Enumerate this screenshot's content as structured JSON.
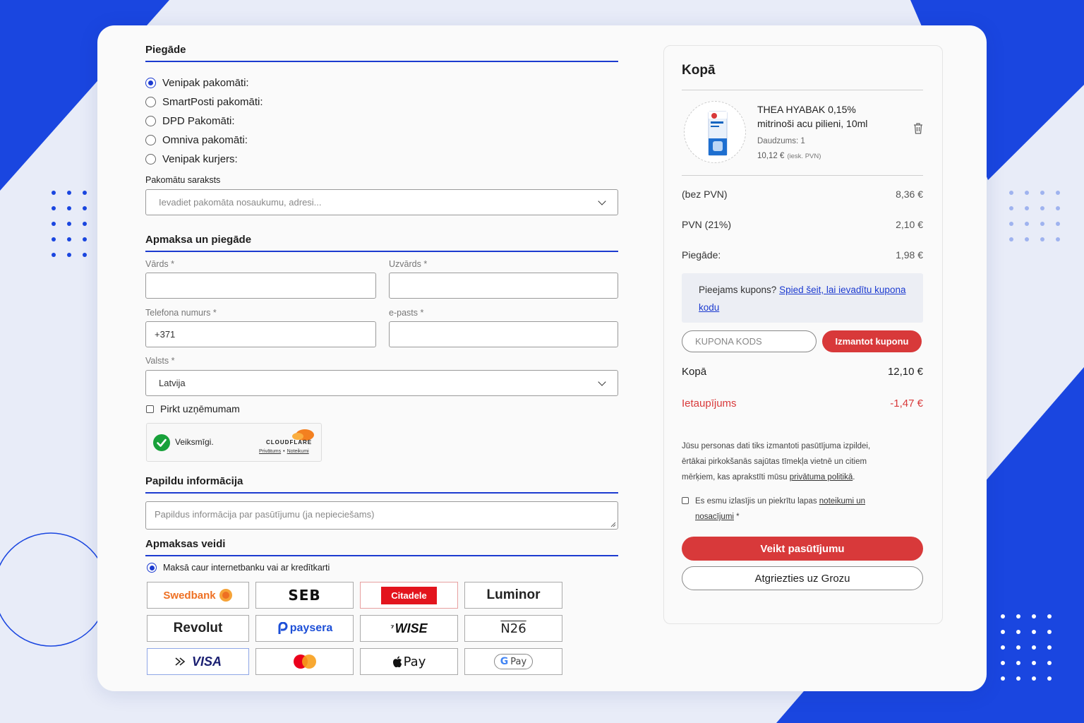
{
  "delivery": {
    "title": "Piegāde",
    "options": [
      {
        "label": "Venipak pakomāti:",
        "selected": true
      },
      {
        "label": "SmartPosti pakomāti:",
        "selected": false
      },
      {
        "label": "DPD Pakomāti:",
        "selected": false
      },
      {
        "label": "Omniva pakomāti:",
        "selected": false
      },
      {
        "label": "Venipak kurjers:",
        "selected": false
      }
    ],
    "locker_list_label": "Pakomātu saraksts",
    "locker_placeholder": "Ievadiet pakomāta nosaukumu, adresi..."
  },
  "billing": {
    "title": "Apmaksa un piegāde",
    "first_name_label": "Vārds *",
    "first_name_value": "",
    "last_name_label": "Uzvārds *",
    "last_name_value": "",
    "phone_label": "Telefona numurs *",
    "phone_value": "+371",
    "email_label": "e-pasts *",
    "email_value": "",
    "country_label": "Valsts *",
    "country_value": "Latvija",
    "company_checkbox_label": "Pirkt uzņēmumam",
    "company_checked": false
  },
  "captcha": {
    "status": "Veiksmīgi.",
    "brand": "CLOUDFLARE",
    "privacy_link": "Privātums",
    "separator": "•",
    "terms_link": "Noteikumi"
  },
  "additional": {
    "title": "Papildu informācija",
    "placeholder": "Papildus informācija par pasūtījumu (ja nepieciešams)"
  },
  "payment": {
    "title": "Apmaksas veidi",
    "method_label": "Maksā caur internetbanku vai ar kredītkarti",
    "method_selected": true,
    "providers": [
      {
        "name": "Swedbank",
        "icon": "swedbank-logo"
      },
      {
        "name": "SEB",
        "icon": "seb-logo"
      },
      {
        "name": "Citadele",
        "icon": "citadele-logo"
      },
      {
        "name": "Luminor",
        "icon": "luminor-logo"
      },
      {
        "name": "Revolut",
        "icon": "revolut-logo"
      },
      {
        "name": "paysera",
        "icon": "paysera-logo"
      },
      {
        "name": "WISE",
        "icon": "wise-logo"
      },
      {
        "name": "N26",
        "icon": "n26-logo"
      },
      {
        "name": "VISA",
        "icon": "visa-logo"
      },
      {
        "name": "",
        "icon": "mastercard-logo"
      },
      {
        "name": "Pay",
        "icon": "apple-pay-logo"
      },
      {
        "name": "Pay",
        "icon": "google-pay-logo"
      }
    ]
  },
  "summary": {
    "title": "Kopā",
    "product": {
      "name": "THEA HYABAK 0,15% mitrinoši acu pilieni, 10ml",
      "quantity": "Daudzums: 1",
      "price": "10,12 €",
      "price_note": "(iesk. PVN)",
      "delete_icon": "trash-icon"
    },
    "lines": [
      {
        "label": "(bez PVN)",
        "value": "8,36 €"
      },
      {
        "label": "PVN (21%)",
        "value": "2,10 €"
      },
      {
        "label": "Piegāde:",
        "value": "1,98 €"
      }
    ],
    "coupon_prompt": "Pieejams kupons?",
    "coupon_link": "Spied šeit, lai ievadītu kupona kodu",
    "coupon_placeholder": "KUPONA KODS",
    "coupon_button": "Izmantot kuponu",
    "total_label": "Kopā",
    "total_value": "12,10 €",
    "savings_label": "Ietaupījums",
    "savings_value": "-1,47 €",
    "privacy_text": "Jūsu personas dati tiks izmantoti pasūtījuma izpildei, ērtākai pirkokšanās sajūtas tīmekļa vietnē un citiem mērķiem, kas aprakstīti mūsu",
    "privacy_link": "privātuma politikā",
    "privacy_end": ".",
    "terms_text": "Es esmu izlasījis un piekrītu lapas",
    "terms_link": "noteikumi un nosacījumi",
    "terms_required": "*",
    "terms_checked": false,
    "order_button": "Veikt pasūtījumu",
    "back_button": "Atgriezties uz Grozu"
  },
  "colors": {
    "accent_blue": "#1c3bd0",
    "action_red": "#d8393a",
    "background": "#e8ecf8"
  }
}
